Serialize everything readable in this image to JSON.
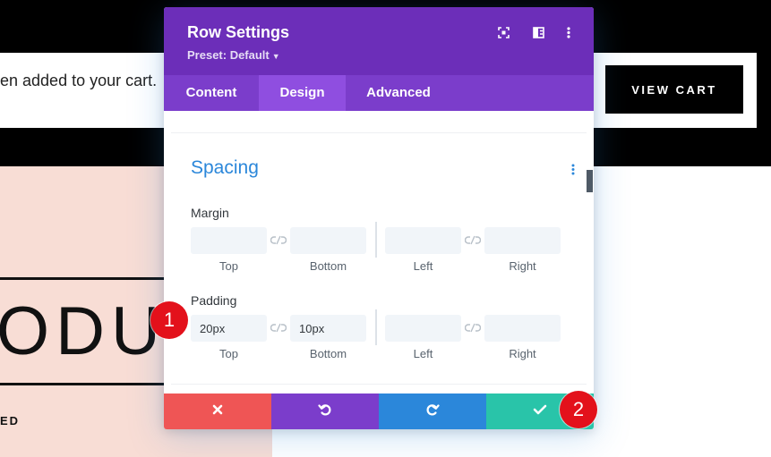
{
  "background": {
    "notice_text": "en added to your cart.",
    "view_cart_label": "VIEW CART",
    "big_text": "ODUC",
    "small_text": "ED"
  },
  "modal": {
    "title": "Row Settings",
    "preset_label": "Preset: Default",
    "header_icons": [
      "focus-icon",
      "sidebar-toggle-icon",
      "more-vertical-icon"
    ],
    "tabs": [
      {
        "label": "Content",
        "active": false
      },
      {
        "label": "Design",
        "active": true
      },
      {
        "label": "Advanced",
        "active": false
      }
    ],
    "section": {
      "title": "Spacing",
      "margin": {
        "label": "Margin",
        "fields": [
          {
            "label": "Top",
            "value": ""
          },
          {
            "label": "Bottom",
            "value": ""
          },
          {
            "label": "Left",
            "value": ""
          },
          {
            "label": "Right",
            "value": ""
          }
        ]
      },
      "padding": {
        "label": "Padding",
        "fields": [
          {
            "label": "Top",
            "value": "20px"
          },
          {
            "label": "Bottom",
            "value": "10px"
          },
          {
            "label": "Left",
            "value": ""
          },
          {
            "label": "Right",
            "value": ""
          }
        ]
      }
    },
    "footer": {
      "buttons": [
        {
          "name": "discard",
          "icon": "close-icon",
          "color": "#ef5555"
        },
        {
          "name": "undo",
          "icon": "undo-icon",
          "color": "#7b3dcb"
        },
        {
          "name": "redo",
          "icon": "redo-icon",
          "color": "#2b87da"
        },
        {
          "name": "save",
          "icon": "check-icon",
          "color": "#29c4a9"
        }
      ]
    }
  },
  "annotations": [
    {
      "number": "1"
    },
    {
      "number": "2"
    }
  ],
  "colors": {
    "header_purple": "#6c2eb9",
    "tab_bar": "#7b3dcb",
    "tab_active": "#8f4ee0",
    "accent_blue": "#2b87da",
    "badge_red": "#e3111b"
  }
}
